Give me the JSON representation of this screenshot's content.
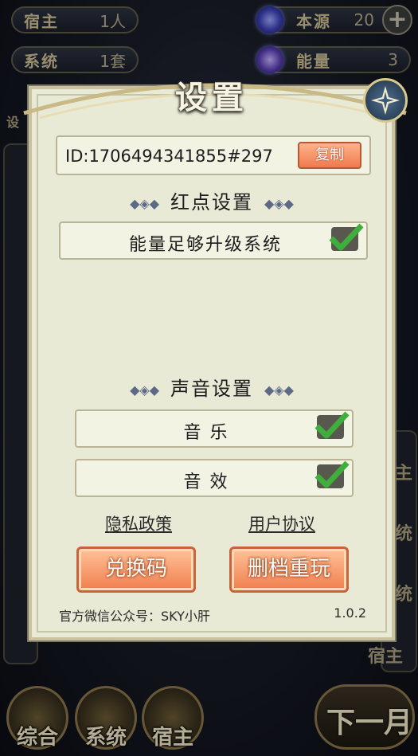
{
  "hud": {
    "host": {
      "label": "宿主",
      "value": "1人"
    },
    "system": {
      "label": "系统",
      "value": "1套"
    },
    "origin": {
      "label": "本源",
      "value": "20"
    },
    "energy": {
      "label": "能量",
      "value": "3"
    },
    "plus_icon": "+"
  },
  "dialog": {
    "title": "设置",
    "close_icon": "compass-star-icon",
    "id_text": "ID:1706494341855#297",
    "copy_label": "复制",
    "redpoint_title": "红点设置",
    "redpoint_option": {
      "label": "能量足够升级系统",
      "checked": true
    },
    "sound_title": "声音设置",
    "music_option": {
      "label": "音 乐",
      "checked": true
    },
    "effect_option": {
      "label": "音 效",
      "checked": true
    },
    "privacy_link": "隐私政策",
    "agreement_link": "用户协议",
    "redeem_button": "兑换码",
    "reset_button": "删档重玩",
    "footer_text": "官方微信公众号：SKY小肝",
    "version": "1.0.2",
    "ornament": "◆◈◆"
  },
  "side": {
    "right_tag_1": "主",
    "right_tag_2": "统",
    "right_tag_3": "统",
    "right_tag_4": "宿主",
    "left_tag": "设"
  },
  "bottom_nav": {
    "general": "综合",
    "system": "系统",
    "host": "宿主",
    "next_month": "下一月"
  },
  "colors": {
    "accent": "#f07e4e",
    "check": "#3fae3a"
  }
}
